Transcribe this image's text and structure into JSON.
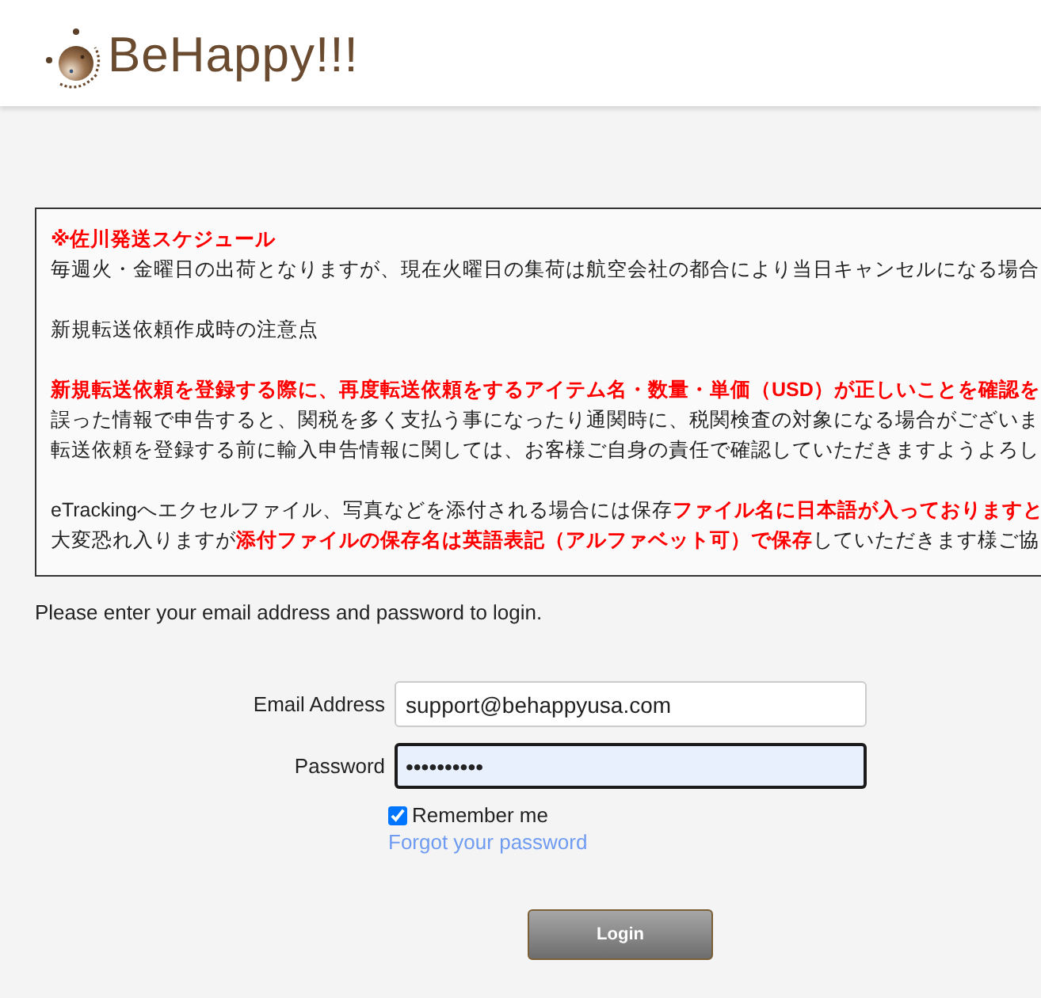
{
  "header": {
    "logo_text": "BeHappy!!!"
  },
  "notice": {
    "paragraphs": [
      {
        "lines": [
          {
            "kind": "alert",
            "text": "※佐川発送スケジュール"
          },
          {
            "kind": "plain",
            "text": "毎週火・金曜日の出荷となりますが、現在火曜日の集荷は航空会社の都合により当日キャンセルになる場合"
          }
        ]
      },
      {
        "lines": [
          {
            "kind": "plain",
            "text": "新規転送依頼作成時の注意点"
          }
        ]
      },
      {
        "lines": [
          {
            "kind": "alert",
            "text": "新規転送依頼を登録する際に、再度転送依頼をするアイテム名・数量・単価（USD）が正しいことを確認を"
          },
          {
            "kind": "plain",
            "text": "誤った情報で申告すると、関税を多く支払う事になったり通関時に、税関検査の対象になる場合がございま"
          },
          {
            "kind": "plain",
            "text": "転送依頼を登録する前に輸入申告情報に関しては、お客様ご自身の責任で確認していただきますようよろし"
          }
        ]
      },
      {
        "lines": [
          {
            "kind": "plain",
            "text": "eTrackingへエクセルファイル、写真などを添付される場合には保存**ファイル名に日本語が入っておりますと**"
          },
          {
            "kind": "plain",
            "text": "大変恐れ入りますが**添付ファイルの保存名は英語表記（アルファベット可）で保存**していただきます様ご協"
          }
        ]
      }
    ]
  },
  "instructions": "Please enter your email address and password to login.",
  "form": {
    "fields": [
      {
        "label": "Email Address",
        "value": "support@behappyusa.com",
        "focused": false,
        "autofilled": false
      },
      {
        "label": "Password",
        "value": "••••••••••",
        "focused": true,
        "autofilled": true
      }
    ],
    "remember_me": {
      "label": "Remember me",
      "checked": true
    },
    "forgot_link": "Forgot your password",
    "submit": "Login"
  }
}
